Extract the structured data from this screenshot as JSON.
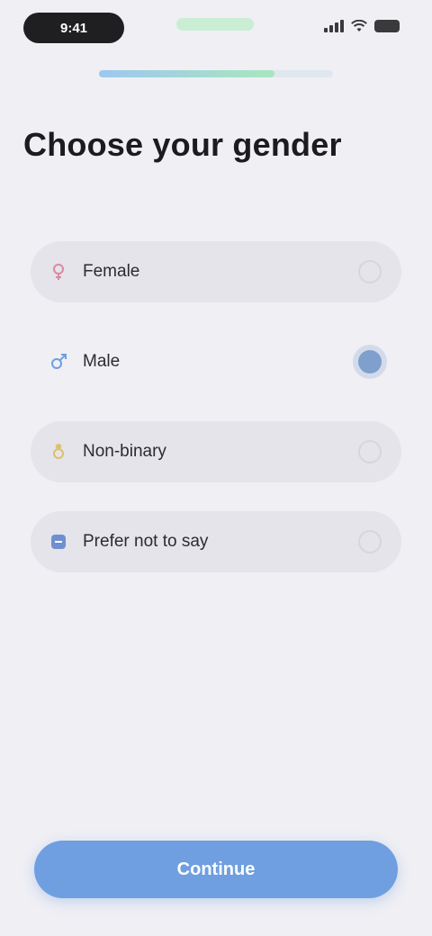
{
  "status_bar": {
    "time": "9:41",
    "icons": [
      "signal-icon",
      "wifi-icon",
      "battery-icon"
    ]
  },
  "progress": {
    "value": 0.75
  },
  "title": "Choose your gender",
  "options": [
    {
      "label": "Female",
      "icon": "female-icon",
      "icon_color": "#d98aa0",
      "selected": false
    },
    {
      "label": "Male",
      "icon": "male-icon",
      "icon_color": "#6f9fe0",
      "selected": true
    },
    {
      "label": "Non-binary",
      "icon": "non-binary-icon",
      "icon_color": "#d9c16a",
      "selected": false
    },
    {
      "label": "Prefer not to say",
      "icon": "prefer-not-icon",
      "icon_color": "#6f8fd0",
      "selected": false
    }
  ],
  "continue_label": "Continue",
  "colors": {
    "background": "#efeff4",
    "accent": "#6f9fe0",
    "progress_start": "#9cc8ef",
    "progress_end": "#a9e6bf"
  }
}
